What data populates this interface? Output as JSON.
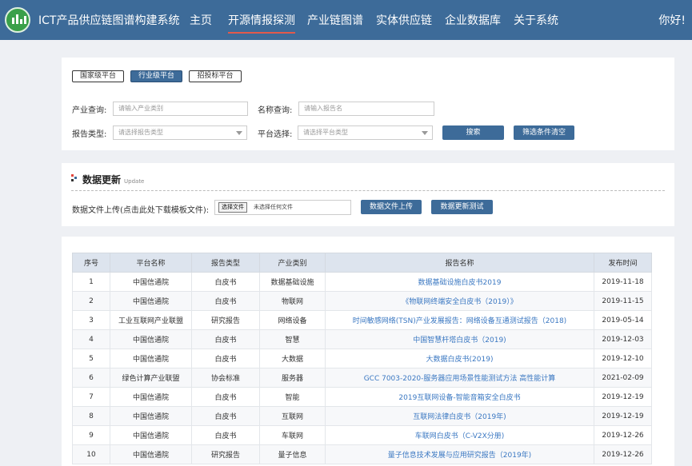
{
  "header": {
    "title": "ICT产品供应链图谱构建系统",
    "nav": [
      "主页",
      "开源情报探测",
      "产业链图谱",
      "实体供应链",
      "企业数据库",
      "关于系统"
    ],
    "active_nav": "开源情报探测",
    "greeting": "你好!"
  },
  "filters": {
    "tabs": [
      "国家级平台",
      "行业级平台",
      "招投标平台"
    ],
    "active_tab": "行业级平台",
    "industry_label": "产业查询:",
    "industry_placeholder": "请输入产业类别",
    "name_label": "名称查询:",
    "name_placeholder": "请输入报告名",
    "type_label": "报告类型:",
    "type_placeholder": "请选择报告类型",
    "platform_label": "平台选择:",
    "platform_placeholder": "请选择平台类型",
    "search_button": "搜索",
    "clear_button": "筛选条件清空"
  },
  "update": {
    "title": "数据更新",
    "subtitle": "Update",
    "upload_label": "数据文件上传(点击此处下载模板文件):",
    "choose_file": "选择文件",
    "no_file": "未选择任何文件",
    "upload_button": "数据文件上传",
    "test_button": "数据更新测试"
  },
  "table": {
    "headers": [
      "序号",
      "平台名称",
      "报告类型",
      "产业类别",
      "报告名称",
      "发布时间"
    ],
    "rows": [
      [
        "1",
        "中国信通院",
        "白皮书",
        "数据基础设施",
        "数据基础设施白皮书2019",
        "2019-11-18"
      ],
      [
        "2",
        "中国信通院",
        "白皮书",
        "物联网",
        "《物联网终端安全白皮书（2019）》",
        "2019-11-15"
      ],
      [
        "3",
        "工业互联网产业联盟",
        "研究报告",
        "网络设备",
        "时间敏感网络(TSN)产业发展报告：网络设备互通测试报告（2018)",
        "2019-05-14"
      ],
      [
        "4",
        "中国信通院",
        "白皮书",
        "智慧",
        "中国智慧杆塔白皮书（2019)",
        "2019-12-03"
      ],
      [
        "5",
        "中国信通院",
        "白皮书",
        "大数据",
        "大数据白皮书(2019)",
        "2019-12-10"
      ],
      [
        "6",
        "绿色计算产业联盟",
        "协会标准",
        "服务器",
        "GCC 7003-2020-服务器应用场景性能测试方法 高性能计算",
        "2021-02-09"
      ],
      [
        "7",
        "中国信通院",
        "白皮书",
        "智能",
        "2019互联网设备-智能音箱安全白皮书",
        "2019-12-19"
      ],
      [
        "8",
        "中国信通院",
        "白皮书",
        "互联网",
        "互联网法律白皮书（2019年)",
        "2019-12-19"
      ],
      [
        "9",
        "中国信通院",
        "白皮书",
        "车联网",
        "车联网白皮书（C-V2X分册)",
        "2019-12-26"
      ],
      [
        "10",
        "中国信通院",
        "研究报告",
        "量子信息",
        "量子信息技术发展与应用研究报告（2019年)",
        "2019-12-26"
      ]
    ]
  }
}
